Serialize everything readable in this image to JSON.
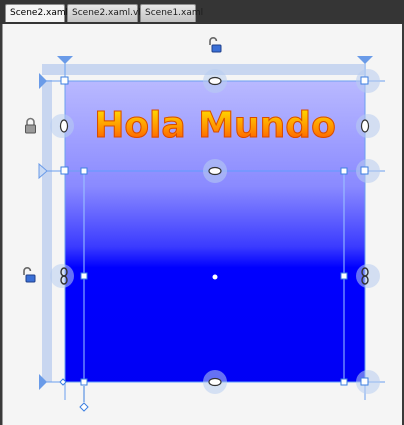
{
  "tabs": [
    {
      "label": "Scene2.xaml",
      "active": true
    },
    {
      "label": "Scene2.xaml.vb",
      "active": false
    },
    {
      "label": "Scene1.xaml",
      "active": false
    }
  ],
  "artboard": {
    "title_text": "Hola Mundo",
    "colors": {
      "gradient_top": "#b7b7ff",
      "gradient_mid": "#6f6ff7",
      "gradient_bottom": "#0000ff",
      "selection": "#3d8cf0",
      "grid_bar": "#c8d6f0",
      "text_top": "#ffd400",
      "text_bottom": "#ff3a00"
    },
    "icons": [
      "lock-open-icon",
      "lock-closed-icon",
      "lock-open-icon"
    ]
  }
}
